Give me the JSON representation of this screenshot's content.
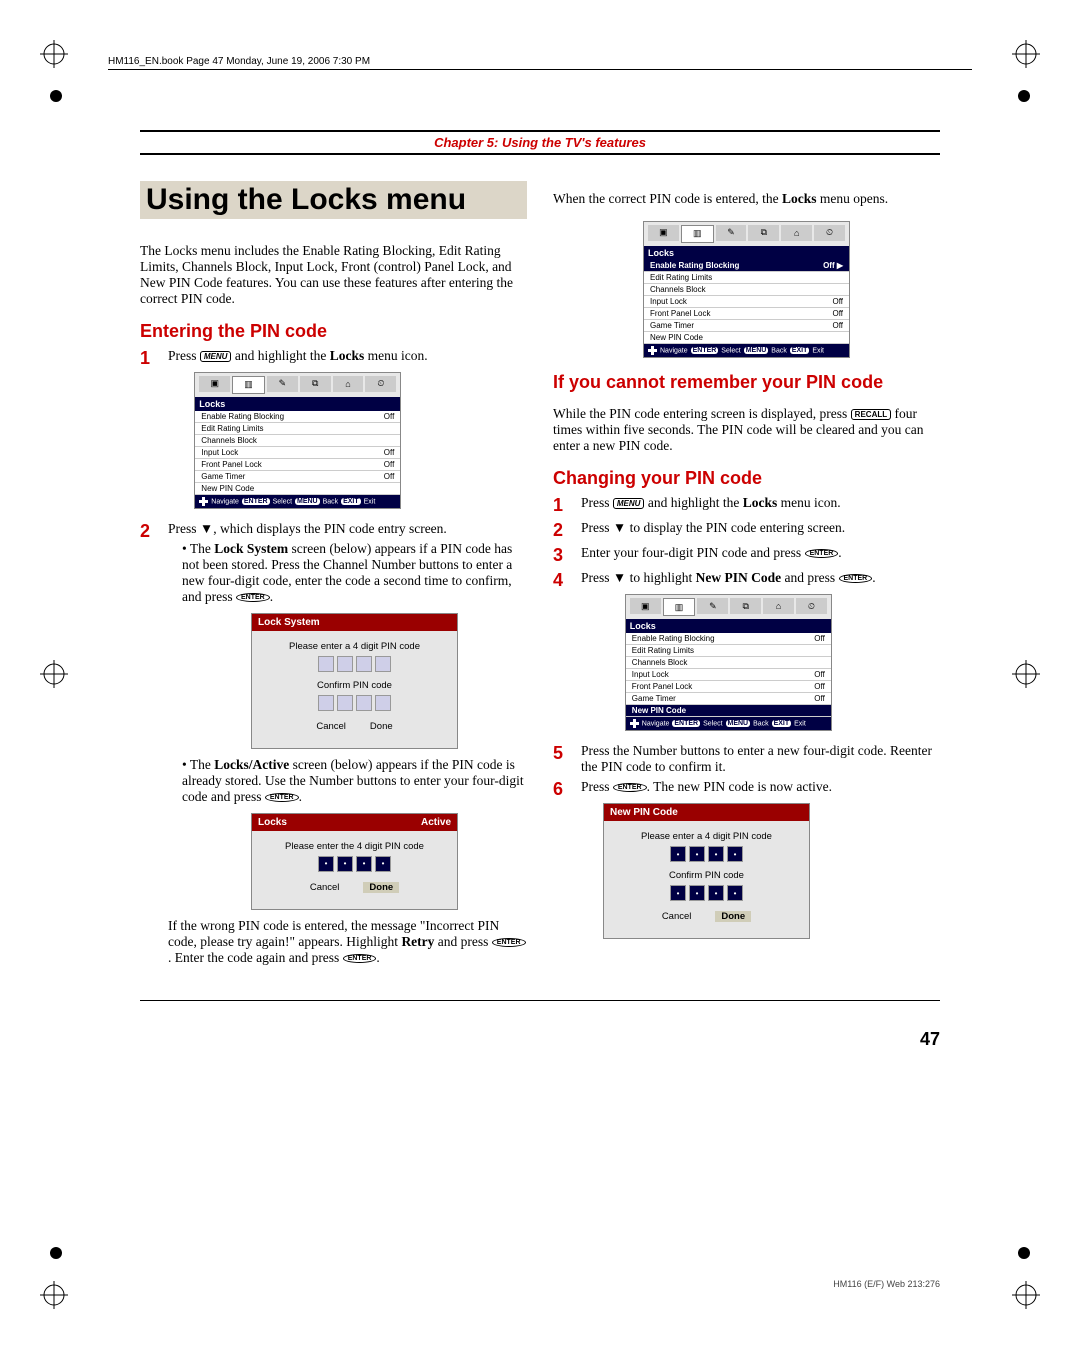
{
  "header_line": "HM116_EN.book  Page 47  Monday, June 19, 2006  7:30 PM",
  "chapter_title": "Chapter 5: Using the TV's features",
  "doc_title": "Using the Locks menu",
  "intro": "The Locks menu includes the Enable Rating Blocking, Edit Rating Limits, Channels Block, Input Lock, Front (control) Panel Lock, and New PIN Code features. You can use these features after entering the correct PIN code.",
  "section_enter_pin": "Entering the PIN code",
  "step1_a": "Press ",
  "key_menu": "MENU",
  "step1_b": " and highlight the ",
  "locks_bold": "Locks",
  "step1_c": " menu icon.",
  "step2_a": "Press ▼, which displays the PIN code entry screen.",
  "step2_b1a": "The ",
  "lock_system_bold": "Lock System",
  "step2_b1b": " screen (below) appears if a PIN code has not been stored. Press the Channel Number buttons to enter a new four-digit code, enter the code a second time to confirm, and press ",
  "key_enter": "ENTER",
  "period": ".",
  "step2_b2a": "The ",
  "locks_active_bold": "Locks/Active",
  "step2_b2b": " screen (below) appears if the PIN code is already stored. Use the Number buttons to enter your four-digit code and press ",
  "wrong_pin_a": "If the wrong PIN code is entered, the message \"Incorrect PIN code, please try again!\" appears. Highlight ",
  "retry_bold": "Retry",
  "wrong_pin_b": " and press ",
  "wrong_pin_c": ". Enter the code again and press ",
  "right_col_intro_a": "When the correct PIN code is entered, the ",
  "right_col_intro_b": " menu opens.",
  "section_forgot": "If you cannot remember your PIN code",
  "forgot_a": "While the PIN code entering screen is displayed, press ",
  "key_recall": "RECALL",
  "forgot_b": " four times within five seconds. The PIN code will be cleared and you can enter a new PIN code.",
  "section_change": "Changing your PIN code",
  "ch1_a": "Press ",
  "ch1_b": " and highlight the ",
  "ch1_c": " menu icon.",
  "ch2": "Press ▼ to display the PIN code entering screen.",
  "ch3_a": "Enter your four-digit PIN code and press ",
  "ch4_a": "Press ▼ to highlight ",
  "new_pin_bold": "New PIN Code",
  "ch4_b": " and press ",
  "ch5": "Press the Number buttons to enter a new four-digit code. Reenter the PIN code to confirm it.",
  "ch6_a": "Press ",
  "ch6_b": ". The new PIN code is now active.",
  "osd": {
    "title": "Locks",
    "rows": {
      "enable": "Enable Rating Blocking",
      "enable_v": "Off",
      "edit": "Edit Rating Limits",
      "chblock": "Channels Block",
      "input": "Input Lock",
      "input_v": "Off",
      "front": "Front Panel Lock",
      "front_v": "Off",
      "game": "Game Timer",
      "game_v": "Off",
      "newpin": "New PIN Code",
      "enable_sel_v": "Off ▶"
    },
    "nav": "Navigate",
    "select": "Select",
    "back": "Back",
    "exit": "Exit",
    "p_enter": "ENTER",
    "p_menu": "MENU",
    "p_exit": "EXIT"
  },
  "dlg_lock_system": {
    "title": "Lock System",
    "msg": "Please enter a 4 digit PIN code",
    "confirm": "Confirm PIN code",
    "cancel": "Cancel",
    "done": "Done"
  },
  "dlg_locks_active": {
    "title": "Locks",
    "title_r": "Active",
    "msg": "Please enter the 4 digit PIN code",
    "cancel": "Cancel",
    "done": "Done"
  },
  "dlg_new_pin": {
    "title": "New PIN Code",
    "msg": "Please enter a 4 digit PIN code",
    "confirm": "Confirm PIN code",
    "cancel": "Cancel",
    "done": "Done"
  },
  "page_number": "47",
  "footer_code": "HM116 (E/F) Web 213:276"
}
